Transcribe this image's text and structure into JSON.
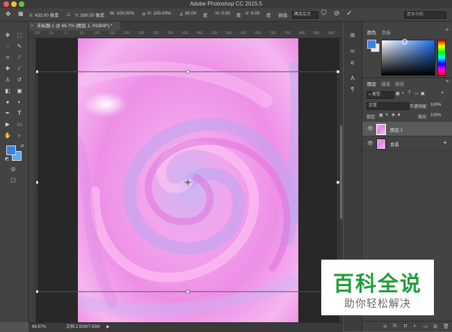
{
  "titlebar": {
    "title": "Adobe Photoshop CC 2015.5"
  },
  "options_bar": {
    "x": "X: 433.00 像素",
    "y": "Y: 590.50 像素",
    "w": "W: 100.00%",
    "h": "H: 100.00%",
    "angle": "90.00",
    "degree1": "度",
    "hskew": "H: 0.00",
    "degree2": "度",
    "vskew": "V: 0.00",
    "degree3": "度",
    "interp_label": "插值:",
    "interp_value": "两次立方",
    "workspace": "基本功能"
  },
  "tab": {
    "title": "未标题-1 @ 66.7% (图层 1, RGB/8*) *"
  },
  "ruler": [
    "100",
    "50",
    "0",
    "50",
    "100",
    "150",
    "200",
    "250",
    "300",
    "350",
    "400",
    "450",
    "500",
    "550",
    "600",
    "650",
    "700",
    "750",
    "800",
    "850",
    "900"
  ],
  "status": {
    "zoom": "66.67%",
    "doc": "文档:2.92M/7.63M"
  },
  "panels": {
    "color_tab": "颜色",
    "swatches_tab": "色板",
    "layers_tab": "图层",
    "channels_tab": "通道",
    "paths_tab": "路径",
    "kind_filter": "类型",
    "blend_mode": "正常",
    "opacity_label": "不透明度:",
    "opacity_value": "100%",
    "lock_label": "锁定:",
    "fill_label": "填充:",
    "fill_value": "100%",
    "layers": [
      {
        "name": "图层 1"
      },
      {
        "name": "背景"
      }
    ]
  },
  "watermark": {
    "title": "百科全说",
    "subtitle": "助你轻松解决"
  },
  "colors": {
    "accent": "#2f7fe0",
    "foreground": "#3b82e6",
    "canvas_pink": "#f0a2ec"
  }
}
